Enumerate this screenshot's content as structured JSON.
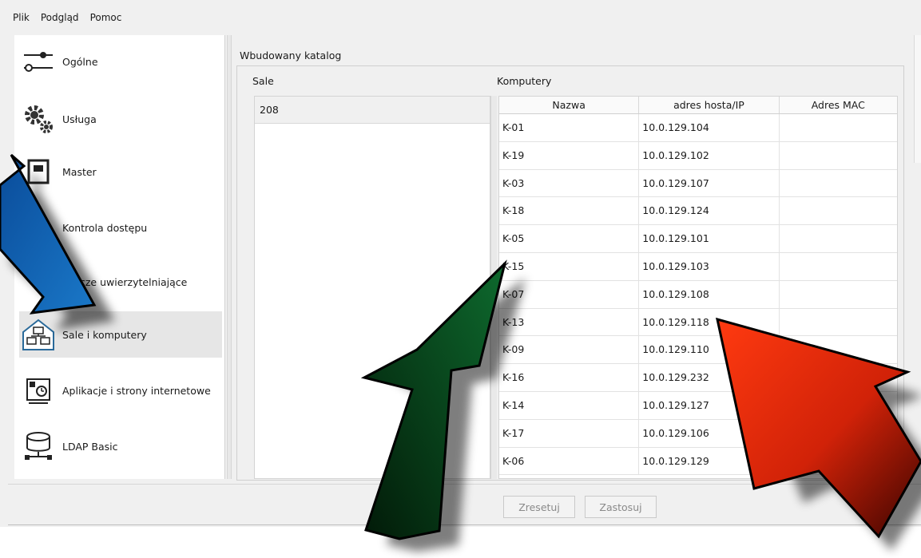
{
  "menu": [
    "Plik",
    "Podgląd",
    "Pomoc"
  ],
  "sidebar": {
    "items": [
      {
        "label": "Ogólne",
        "icon": "sliders-icon"
      },
      {
        "label": "Usługa",
        "icon": "gears-icon"
      },
      {
        "label": "Master",
        "icon": "master-icon"
      },
      {
        "label": "Kontrola dostępu",
        "icon": "access-control-icon"
      },
      {
        "label": "Klucze uwierzytelniające",
        "icon": "key-icon"
      },
      {
        "label": "Sale i komputery",
        "icon": "house-computers-icon"
      },
      {
        "label": "Aplikacje i strony internetowe",
        "icon": "app-clock-icon"
      },
      {
        "label": "LDAP Basic",
        "icon": "database-network-icon"
      }
    ],
    "visible_labels": [
      "Ogólne",
      "Usługa",
      "Master",
      "Kontrola dostępu",
      "cze uwierzytelniające",
      "Sale i komputery",
      "Aplikacje i strony internetowe",
      "LDAP Basic"
    ],
    "active_index": 5
  },
  "main": {
    "group_title": "Wbudowany katalog",
    "rooms_label": "Sale",
    "rooms": [
      "208"
    ],
    "computers_label": "Komputery",
    "columns": [
      "Nazwa",
      "adres hosta/IP",
      "Adres MAC"
    ],
    "rows": [
      [
        "K-01",
        "10.0.129.104",
        ""
      ],
      [
        "K-19",
        "10.0.129.102",
        ""
      ],
      [
        "K-03",
        "10.0.129.107",
        ""
      ],
      [
        "K-18",
        "10.0.129.124",
        ""
      ],
      [
        "K-05",
        "10.0.129.101",
        ""
      ],
      [
        "K-15",
        "10.0.129.103",
        ""
      ],
      [
        "K-07",
        "10.0.129.108",
        ""
      ],
      [
        "K-13",
        "10.0.129.118",
        ""
      ],
      [
        "K-09",
        "10.0.129.110",
        ""
      ],
      [
        "K-16",
        "10.0.129.232",
        ""
      ],
      [
        "K-14",
        "10.0.129.127",
        ""
      ],
      [
        "K-17",
        "10.0.129.106",
        ""
      ],
      [
        "K-06",
        "10.0.129.129",
        ""
      ]
    ]
  },
  "buttons": {
    "reset": "Zresetuj",
    "apply": "Zastosuj"
  },
  "colors": {
    "arrow_blue": "#1464b4",
    "arrow_green": "#0a5a28",
    "arrow_red": "#e02a10",
    "active_nav": "#e6e6e6"
  }
}
